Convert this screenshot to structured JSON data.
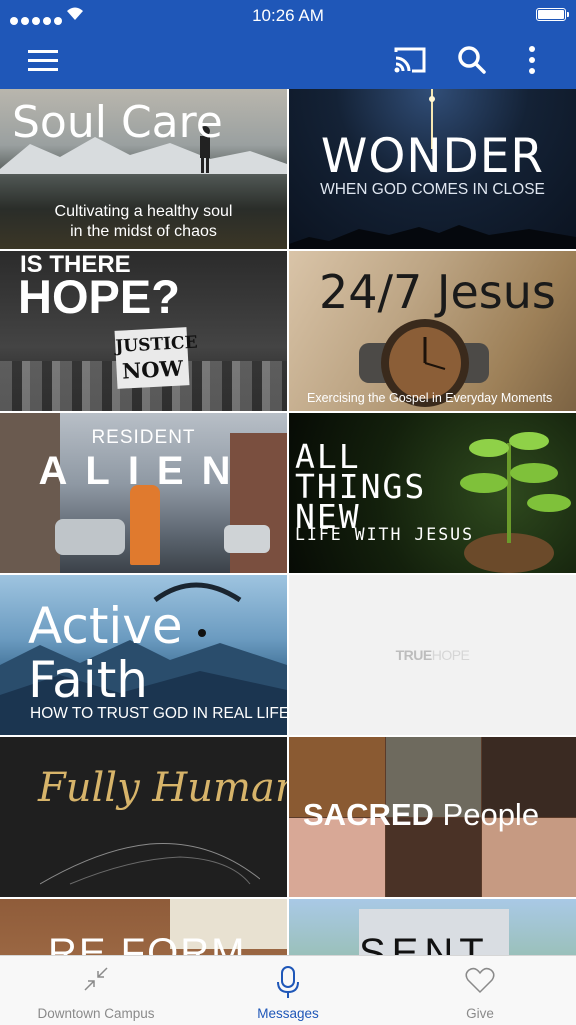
{
  "status_bar": {
    "time": "10:26 AM"
  },
  "app_bar": {
    "menu_icon": "hamburger-icon",
    "cast_icon": "cast-icon",
    "search_icon": "search-icon",
    "more_icon": "more-vertical-icon"
  },
  "series": [
    {
      "title": "Soul Care",
      "subtitle_line1": "Cultivating a healthy soul",
      "subtitle_line2": "in the midst of chaos"
    },
    {
      "title": "WONDER",
      "subtitle": "WHEN GOD COMES IN CLOSE"
    },
    {
      "title_line1": "IS THERE",
      "title_line2": "HOPE?",
      "sign_text_1": "JUSTICE",
      "sign_text_2": "NOW"
    },
    {
      "title": "24/7 Jesus",
      "subtitle": "Exercising the Gospel in Everyday Moments"
    },
    {
      "title_line1": "RESIDENT",
      "title_line2": "ALIEN"
    },
    {
      "title_line1": "ALL",
      "title_line2": "THINGS",
      "title_line3": "NEW",
      "subtitle": "LIFE WITH JESUS"
    },
    {
      "title_line1": "Active",
      "title_line2": "Faith",
      "subtitle": "HOW TO TRUST GOD IN REAL LIFE"
    },
    {
      "logo_part1": "TRUE",
      "logo_part2": "HOPE"
    },
    {
      "title": "Fully Human"
    },
    {
      "title_bold": "SACRED",
      "title_light": "People"
    },
    {
      "title": "RE FORM"
    },
    {
      "title": "SENT"
    }
  ],
  "tabs": [
    {
      "label": "Downtown Campus",
      "icon": "compress-arrows-icon"
    },
    {
      "label": "Messages",
      "icon": "microphone-icon"
    },
    {
      "label": "Give",
      "icon": "heart-icon"
    }
  ],
  "colors": {
    "brand_blue": "#1f57b8",
    "tab_inactive": "#8a8a8a"
  }
}
